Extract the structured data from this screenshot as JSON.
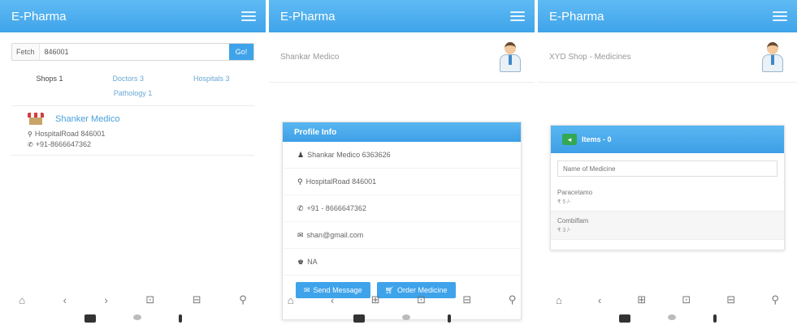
{
  "screens": [
    {
      "app_title": "E-Pharma",
      "search": {
        "prefix": "Fetch",
        "value": "846001",
        "button": "Go!"
      },
      "tabs": [
        "Shops 1",
        "Doctors 3",
        "Hospitals 3"
      ],
      "tab_second_row": "Pathology 1",
      "shop": {
        "name": "Shanker Medico",
        "address": "HospitalRoad 846001",
        "phone": "+91-8666647362"
      },
      "nav": [
        "⌂",
        "‹",
        "›",
        "⊡",
        "⊟",
        "⚲"
      ]
    },
    {
      "app_title": "E-Pharma",
      "header_name": "Shankar Medico",
      "card_title": "Profile Info",
      "rows": [
        {
          "icon": "user-icon",
          "glyph": "♟",
          "text": "Shankar Medico 6363626"
        },
        {
          "icon": "location-icon",
          "glyph": "⚲",
          "text": "HospitalRoad 846001"
        },
        {
          "icon": "phone-icon",
          "glyph": "✆",
          "text": "+91 - 8666647362"
        },
        {
          "icon": "mail-icon",
          "glyph": "✉",
          "text": "shan@gmail.com"
        },
        {
          "icon": "hat-icon",
          "glyph": "♚",
          "text": "NA"
        }
      ],
      "send_button": "Send Message",
      "order_button": "Order Medicine",
      "nav": [
        "⌂",
        "‹",
        "⊞",
        "⊡",
        "⊟",
        "⚲"
      ]
    },
    {
      "app_title": "E-Pharma",
      "header_name": "XYD Shop - Medicines",
      "items_title": "Items - 0",
      "search_placeholder": "Name of Medicine",
      "medicines": [
        {
          "name": "Paracetamo",
          "price": "₹ 5 /-"
        },
        {
          "name": "Combiflam",
          "price": "₹ 3 /-"
        }
      ],
      "nav": [
        "⌂",
        "‹",
        "⊞",
        "⊡",
        "⊟",
        "⚲"
      ]
    }
  ]
}
